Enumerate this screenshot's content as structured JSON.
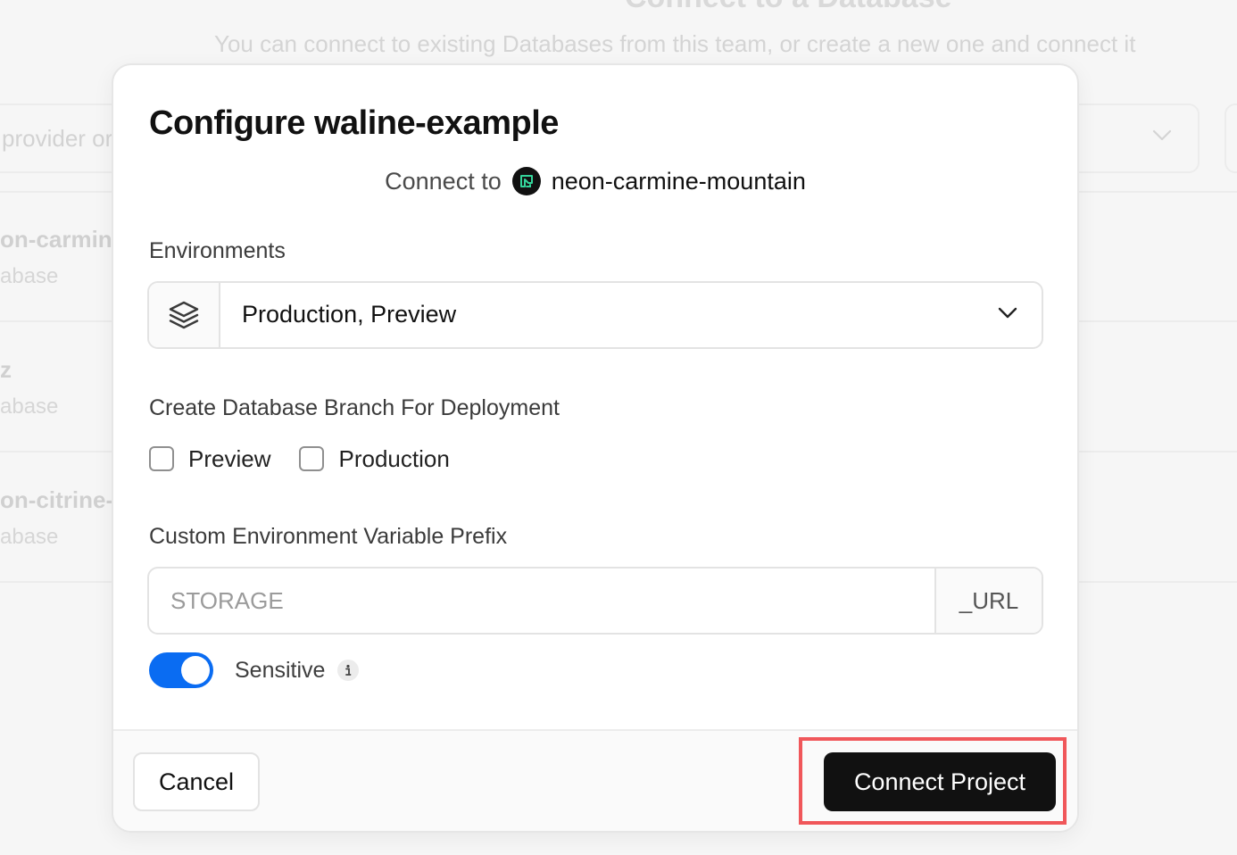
{
  "background": {
    "page_title": "Connect to a Database",
    "subtitle": "You can connect to existing Databases from this team, or create a new one and connect it",
    "search_placeholder": "provider or",
    "rows": [
      {
        "name": "on-carmin",
        "type": "abase"
      },
      {
        "name": "z",
        "type": "abase"
      },
      {
        "name": "on-citrine-",
        "type": "abase"
      }
    ]
  },
  "modal": {
    "title": "Configure waline-example",
    "connect_prefix": "Connect to",
    "connect_target": "neon-carmine-mountain",
    "environments": {
      "label": "Environments",
      "value": "Production, Preview",
      "icon": "layers-icon"
    },
    "branch": {
      "label": "Create Database Branch For Deployment",
      "options": [
        {
          "label": "Preview",
          "checked": false
        },
        {
          "label": "Production",
          "checked": false
        }
      ]
    },
    "prefix": {
      "label": "Custom Environment Variable Prefix",
      "placeholder": "STORAGE",
      "value": "",
      "suffix": "_URL"
    },
    "sensitive": {
      "label": "Sensitive",
      "enabled": true
    },
    "footer": {
      "cancel_label": "Cancel",
      "connect_label": "Connect Project"
    }
  },
  "colors": {
    "accent_toggle": "#0a6cf2",
    "primary_button": "#111111",
    "highlight": "#f0575a",
    "neon_brand": "#34d59a"
  }
}
